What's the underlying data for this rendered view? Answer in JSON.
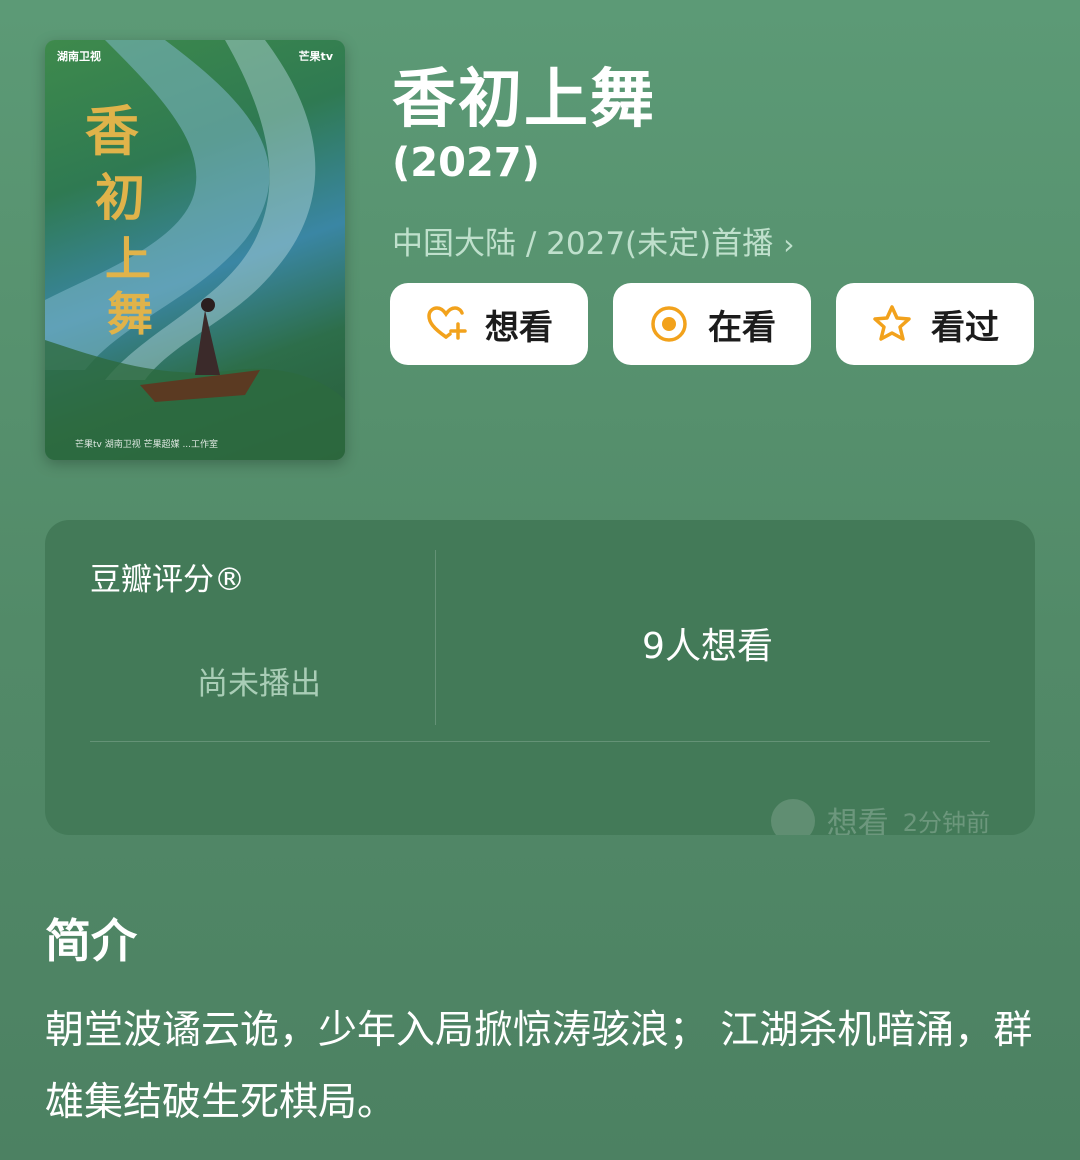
{
  "poster": {
    "logo_left": "湖南卫视",
    "logo_right": "芒果tv",
    "footer_logos": "芒果tv  湖南卫视  芒果超媒  ...工作室"
  },
  "show": {
    "title": "香初上舞",
    "year": "(2027)",
    "meta": "中国大陆 / 2027(未定)首播"
  },
  "actions": [
    {
      "label": "想看",
      "icon": "heart-plus-icon"
    },
    {
      "label": "在看",
      "icon": "target-icon"
    },
    {
      "label": "看过",
      "icon": "star-outline-icon"
    }
  ],
  "rating_card": {
    "label": "豆瓣评分®",
    "status": "尚未播出",
    "want_count": "9人想看",
    "activity": {
      "action": "想看",
      "time": "2分钟前"
    }
  },
  "intro": {
    "heading": "简介",
    "text": "朝堂波谲云诡，少年入局掀惊涛骇浪； 江湖杀机暗涌，群雄集结破生死棋局。"
  },
  "colors": {
    "background": "#5c9a76",
    "card": "#437a58",
    "accent_icon": "#f2a21c"
  }
}
